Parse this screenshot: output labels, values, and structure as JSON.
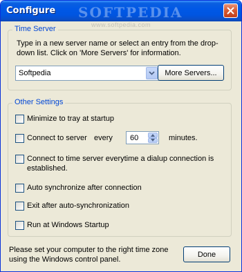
{
  "window": {
    "title": "Configure",
    "title_watermark": "SOFTPEDIA",
    "url_watermark": "www.softpedia.com"
  },
  "time_server": {
    "legend": "Time Server",
    "description": "Type in a new server name or select an entry from the drop-down list. Click on 'More Servers' for information.",
    "server_value": "Softpedia",
    "more_servers_label": "More Servers..."
  },
  "other_settings": {
    "legend": "Other Settings",
    "minimize_label": "Minimize to tray at startup",
    "minimize_checked": false,
    "connect_label": "Connect to server",
    "every_label": "every",
    "interval_value": "60",
    "minutes_label": "minutes.",
    "connect_checked": false,
    "dialup_label": "Connect to time server everytime a dialup connection is established.",
    "dialup_checked": false,
    "autosync_label": "Auto synchronize after connection",
    "autosync_checked": false,
    "exit_label": "Exit after auto-synchronization",
    "exit_checked": false,
    "startup_label": "Run at Windows Startup",
    "startup_checked": false
  },
  "footer": {
    "note": "Please set your computer to the right time zone using the Windows control panel.",
    "done_label": "Done"
  },
  "colors": {
    "titlebar": "#0055e0",
    "dialog_bg": "#ece9d8",
    "legend_text": "#0046d5",
    "close_button": "#d5582f"
  }
}
